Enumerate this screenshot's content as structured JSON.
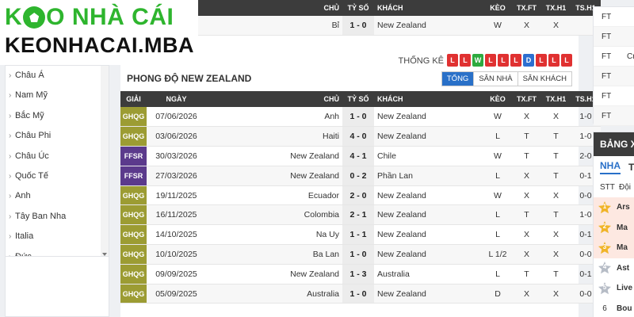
{
  "logo": {
    "line1_a": "K",
    "line1_b": "O NHÀ CÁI",
    "line2": "KEONHACAI.MBA"
  },
  "sidebar": {
    "items": [
      "Châu Á",
      "Nam Mỹ",
      "Bắc Mỹ",
      "Châu Phi",
      "Châu Úc",
      "Quốc Tế",
      "Anh",
      "Tây Ban Nha",
      "Italia",
      "Đức"
    ]
  },
  "columns": {
    "league": "GIẢI",
    "date": "NGÀY",
    "home": "CHỦ",
    "score": "TỶ SỐ",
    "away": "KHÁCH",
    "keo": "KÈO",
    "txft": "TX.FT",
    "txh1": "TX.H1",
    "tsh1": "TS.H1"
  },
  "top_match": {
    "home": "Bỉ",
    "score": "1 - 0",
    "away": "New Zealand",
    "keo": "W",
    "txft": "X",
    "txh1": "X",
    "tsh1": ""
  },
  "stats": {
    "label": "THỐNG KÊ",
    "badges": [
      "L",
      "L",
      "W",
      "L",
      "L",
      "L",
      "D",
      "L",
      "L",
      "L"
    ]
  },
  "form": {
    "title": "PHONG ĐỘ NEW ZEALAND",
    "tabs": [
      "TỔNG",
      "SÂN NHÀ",
      "SÂN KHÁCH"
    ],
    "active_tab": 0
  },
  "matches": [
    {
      "league": "GHQG",
      "date": "07/06/2026",
      "home": "Anh",
      "score": "1 - 0",
      "away": "New Zealand",
      "keo": "W",
      "txft": "X",
      "txh1": "X",
      "tsh1": "1-0"
    },
    {
      "league": "GHQG",
      "date": "03/06/2026",
      "home": "Haiti",
      "score": "4 - 0",
      "away": "New Zealand",
      "keo": "L",
      "txft": "T",
      "txh1": "T",
      "tsh1": "1-0"
    },
    {
      "league": "FFSR",
      "date": "30/03/2026",
      "home": "New Zealand",
      "score": "4 - 1",
      "away": "Chile",
      "keo": "W",
      "txft": "T",
      "txh1": "T",
      "tsh1": "2-0"
    },
    {
      "league": "FFSR",
      "date": "27/03/2026",
      "home": "New Zealand",
      "score": "0 - 2",
      "away": "Phần Lan",
      "keo": "L",
      "txft": "X",
      "txh1": "T",
      "tsh1": "0-1"
    },
    {
      "league": "GHQG",
      "date": "19/11/2025",
      "home": "Ecuador",
      "score": "2 - 0",
      "away": "New Zealand",
      "keo": "W",
      "txft": "X",
      "txh1": "X",
      "tsh1": "0-0"
    },
    {
      "league": "GHQG",
      "date": "16/11/2025",
      "home": "Colombia",
      "score": "2 - 1",
      "away": "New Zealand",
      "keo": "L",
      "txft": "T",
      "txh1": "T",
      "tsh1": "1-0"
    },
    {
      "league": "GHQG",
      "date": "14/10/2025",
      "home": "Na Uy",
      "score": "1 - 1",
      "away": "New Zealand",
      "keo": "L",
      "txft": "X",
      "txh1": "X",
      "tsh1": "0-1"
    },
    {
      "league": "GHQG",
      "date": "10/10/2025",
      "home": "Ba Lan",
      "score": "1 - 0",
      "away": "New Zealand",
      "keo": "L 1/2",
      "txft": "X",
      "txh1": "X",
      "tsh1": "0-0"
    },
    {
      "league": "GHQG",
      "date": "09/09/2025",
      "home": "New Zealand",
      "score": "1 - 3",
      "away": "Australia",
      "keo": "L",
      "txft": "T",
      "txh1": "T",
      "tsh1": "0-1"
    },
    {
      "league": "GHQG",
      "date": "05/09/2025",
      "home": "Australia",
      "score": "1 - 0",
      "away": "New Zealand",
      "keo": "D",
      "txft": "X",
      "txh1": "X",
      "tsh1": "0-0"
    }
  ],
  "right_panel": {
    "ft_rows": [
      "FT",
      "FT",
      "FT",
      "FT",
      "FT",
      "FT"
    ],
    "ft_extra": "Cr",
    "standings_title": "BẢNG XẾ",
    "tab_active": "NHA",
    "tab_other": "T",
    "col_stt": "STT",
    "col_team": "Đội",
    "rows": [
      {
        "rank": "1",
        "team": "Ars",
        "color": "#f0b429"
      },
      {
        "rank": "2",
        "team": "Ma",
        "color": "#f0b429"
      },
      {
        "rank": "3",
        "team": "Ma",
        "color": "#f0b429"
      },
      {
        "rank": "4",
        "team": "Ast",
        "color": "#b6bcc6"
      },
      {
        "rank": "5",
        "team": "Live",
        "color": "#b6bcc6"
      },
      {
        "rank": "6",
        "team": "Bou",
        "color": ""
      }
    ]
  }
}
